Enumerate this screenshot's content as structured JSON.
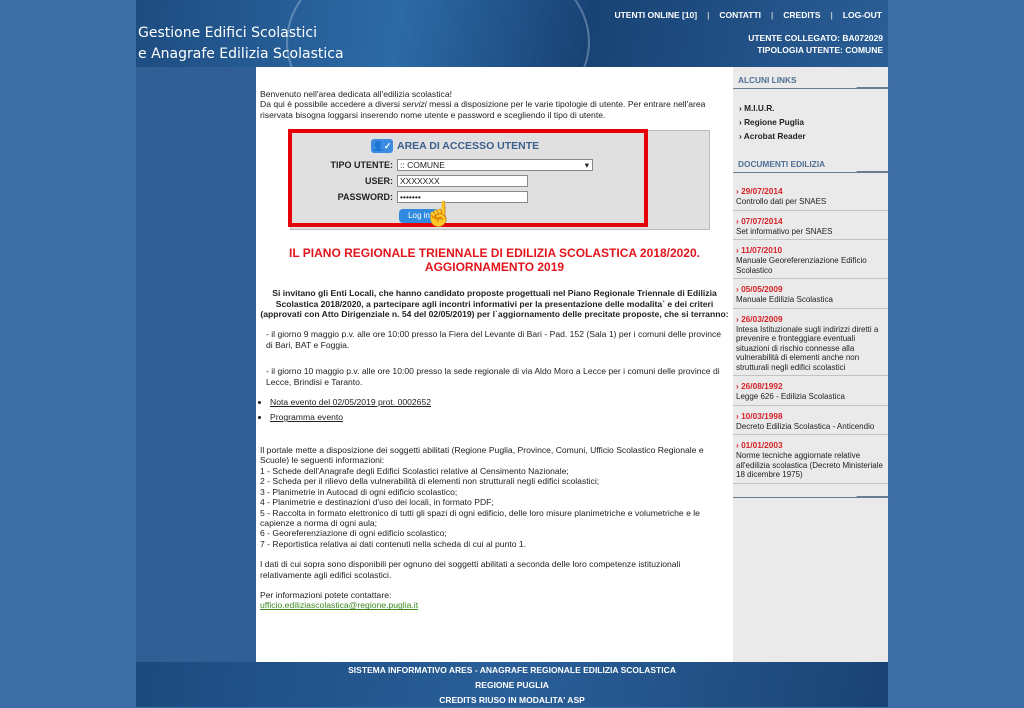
{
  "header": {
    "title_line1": "Gestione Edifici Scolastici",
    "title_line2": "e Anagrafe Edilizia Scolastica",
    "nav": [
      "UTENTI ONLINE [10]",
      "CONTATTI",
      "CREDITS",
      "LOG-OUT"
    ],
    "user_connected": "UTENTE COLLEGATO: BA072029",
    "user_type": "TIPOLOGIA UTENTE: COMUNE"
  },
  "main": {
    "welcome": "Benvenuto nell'area dedicata all'edilizia scolastica!",
    "intro_a": "Da qui è possibile accedere a diversi ",
    "intro_em": "servizi",
    "intro_b": " messi a disposizione per le varie tipologie di utente. Per entrare nell'area riservata bisogna loggarsi inserendo nome utente e password e scegliendo il tipo di utente.",
    "login": {
      "title": "AREA DI ACCESSO UTENTE",
      "type_label": "TIPO UTENTE:",
      "type_value": ":: COMUNE",
      "user_label": "USER:",
      "user_value": "XXXXXXX",
      "password_label": "PASSWORD:",
      "password_value": "•••••••",
      "button": "Log in"
    },
    "heading": "IL PIANO REGIONALE TRIENNALE DI EDILIZIA SCOLASTICA 2018/2020. AGGIORNAMENTO 2019",
    "invite": "Si invitano gli Enti Locali, che hanno candidato proposte progettuali nel Piano Regionale Triennale di Edilizia Scolastica 2018/2020, a partecipare agli incontri informativi per la presentazione delle modalita` e dei criteri (approvati con Atto Dirigenziale n. 54 del 02/05/2019) per l`aggiornamento delle precitate proposte, che si terranno:",
    "event1": "- il giorno 9 maggio p.v. alle ore 10:00 presso la Fiera del Levante di Bari - Pad. 152 (Sala 1) per i comuni delle province di Bari, BAT e Foggia.",
    "event2": "- il giorno 10 maggio p.v. alle ore 10:00 presso la sede regionale di via Aldo Moro a Lecce per i comuni delle province di Lecce, Brindisi e Taranto.",
    "links": [
      "Nota evento del 02/05/2019 prot. 0002652",
      "Programma evento"
    ],
    "portal_intro": "Il portale mette a disposizione dei soggetti abilitati (Regione Puglia, Province, Comuni, Ufficio Scolastico Regionale  e Scuole) le seguenti informazioni:",
    "items": [
      "1 - Schede dell'Anagrafe degli Edifici Scolastici relative al Censimento Nazionale;",
      "2 - Scheda per il rilievo della vulnerabilità di elementi non strutturali negli edifici scolastici;",
      "3 - Planimetrie in Autocad di ogni edificio scolastico;",
      "4 - Planimetrie e destinazioni d'uso dei locali, in formato PDF;",
      "5 - Raccolta in formato elettronico di tutti gli spazi di ogni edificio, delle loro misure planimetriche e volumetriche e le capienze a norma di ogni aula;",
      "6 - Georeferenziazione di ogni edificio scolastico;",
      "7 - Reportistica relativa ai dati contenuti nella scheda di cui al punto 1."
    ],
    "availability": "I dati di cui sopra sono disponibili per ognuno dei soggetti abilitati a seconda delle loro competenze istituzionali relativamente agli edifici scolastici.",
    "contact_label": "Per informazioni potete contattare:",
    "contact_email": "ufficio.ediliziascolastica@regione.puglia.it"
  },
  "sidebar": {
    "links_title": "ALCUNI LINKS",
    "links": [
      "› M.I.U.R.",
      "› Regione Puglia",
      "› Acrobat Reader"
    ],
    "docs_title": "DOCUMENTI EDILIZIA",
    "docs": [
      {
        "date": "› 29/07/2014",
        "title": "Controllo dati per SNAES"
      },
      {
        "date": "› 07/07/2014",
        "title": "Set informativo per SNAES"
      },
      {
        "date": "› 11/07/2010",
        "title": "Manuale Georeferenziazione Edificio Scolastico"
      },
      {
        "date": "› 05/05/2009",
        "title": "Manuale Edilizia Scolastica"
      },
      {
        "date": "› 26/03/2009",
        "title": "Intesa Istituzionale sugli indirizzi diretti a prevenire e fronteggiare eventuali situazioni di rischio connesse alla vulnerabilità di elementi anche non strutturali negli edifici scolastici"
      },
      {
        "date": "› 26/08/1992",
        "title": "Legge 626 - Edilizia Scolastica"
      },
      {
        "date": "› 10/03/1998",
        "title": "Decreto Edilizia Scolastica - Anticendio"
      },
      {
        "date": "› 01/01/2003",
        "title": "Norme tecniche aggiornate relative all'edilizia scolastica (Decreto Ministeriale 18 dicembre 1975)"
      }
    ]
  },
  "footer": [
    "SISTEMA INFORMATIVO ARES - ANAGRAFE REGIONALE EDILIZIA SCOLASTICA",
    "REGIONE PUGLIA",
    "CREDITS RIUSO IN MODALITA' ASP"
  ],
  "colors": {
    "accent_red": "#e3141b",
    "header_blue": "#1d4c80",
    "button_blue": "#2f8ae0"
  }
}
